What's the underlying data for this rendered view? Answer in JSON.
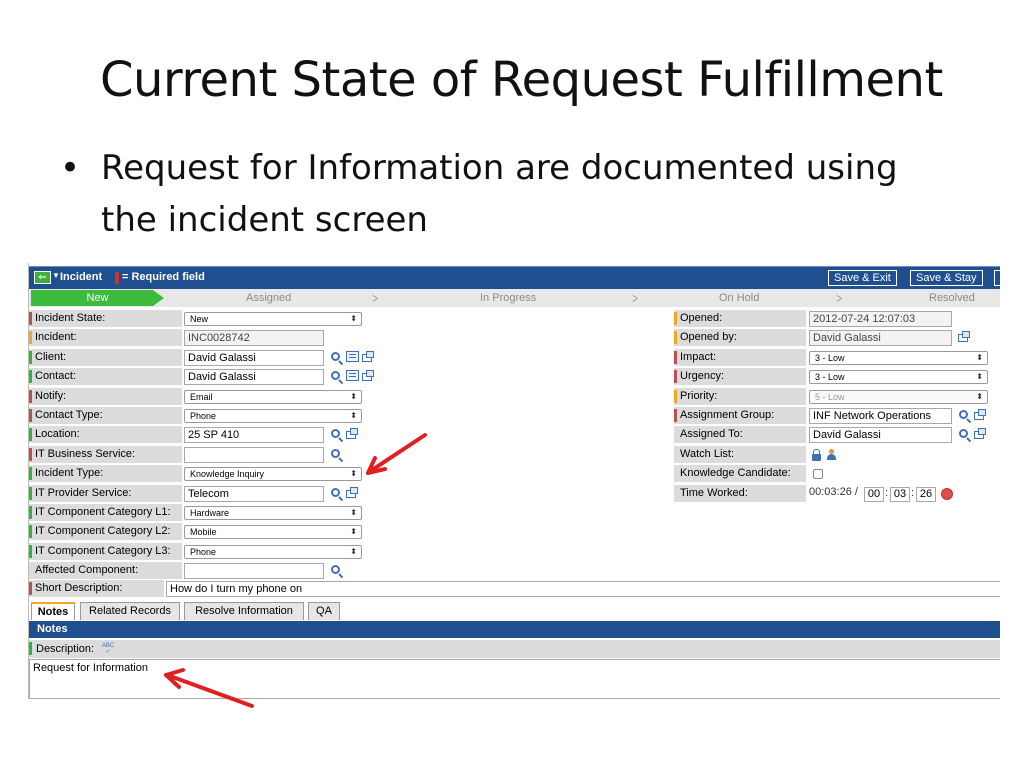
{
  "slide": {
    "title": "Current State of Request Fulfillment",
    "bullet": "Request for Information are documented using the incident screen"
  },
  "topbar": {
    "title": "Incident",
    "required_legend": "= Required field",
    "back_icon": "back-arrow-icon",
    "buttons": [
      "Save & Exit",
      "Save & Stay"
    ]
  },
  "flow": {
    "steps": [
      "New",
      "Assigned",
      "In Progress",
      "On Hold",
      "Resolved"
    ],
    "active": "New"
  },
  "left_fields": [
    {
      "label": "Incident State:",
      "mark": "red",
      "kind": "select",
      "value": "New"
    },
    {
      "label": "Incident:",
      "mark": "orange",
      "kind": "readonly",
      "value": "INC0028742"
    },
    {
      "label": "Client:",
      "mark": "green",
      "kind": "lookup",
      "value": "David Galassi",
      "icons": [
        "search-icon",
        "card-icon",
        "link-icon"
      ]
    },
    {
      "label": "Contact:",
      "mark": "green",
      "kind": "lookup",
      "value": "David Galassi",
      "icons": [
        "search-icon",
        "card-icon",
        "link-icon"
      ]
    },
    {
      "label": "Notify:",
      "mark": "red",
      "kind": "select",
      "value": "Email"
    },
    {
      "label": "Contact Type:",
      "mark": "red",
      "kind": "select",
      "value": "Phone"
    },
    {
      "label": "Location:",
      "mark": "green",
      "kind": "lookup",
      "value": "25 SP 410",
      "icons": [
        "search-icon",
        "link-icon"
      ]
    },
    {
      "label": "IT Business Service:",
      "mark": "red",
      "kind": "lookup",
      "value": "",
      "icons": [
        "search-icon"
      ]
    },
    {
      "label": "Incident Type:",
      "mark": "green",
      "kind": "select",
      "value": "Knowledge Inquiry"
    },
    {
      "label": "IT Provider Service:",
      "mark": "green",
      "kind": "lookup",
      "value": "Telecom",
      "icons": [
        "search-icon",
        "link-icon"
      ]
    },
    {
      "label": "IT Component Category L1:",
      "mark": "green",
      "kind": "select",
      "value": "Hardware"
    },
    {
      "label": "IT Component Category L2:",
      "mark": "green",
      "kind": "select",
      "value": "Mobile"
    },
    {
      "label": "IT Component Category L3:",
      "mark": "green",
      "kind": "select",
      "value": "Phone"
    },
    {
      "label": "Affected Component:",
      "mark": "none",
      "kind": "lookup",
      "value": "",
      "icons": [
        "search-icon"
      ]
    }
  ],
  "right_fields": [
    {
      "label": "Opened:",
      "mark": "orange",
      "kind": "readonly",
      "value": "2012-07-24 12:07:03"
    },
    {
      "label": "Opened by:",
      "mark": "orange",
      "kind": "readonly",
      "value": "David Galassi",
      "icons": [
        "link-icon"
      ]
    },
    {
      "label": "Impact:",
      "mark": "red",
      "kind": "select",
      "value": "3 - Low"
    },
    {
      "label": "Urgency:",
      "mark": "red",
      "kind": "select",
      "value": "3 - Low"
    },
    {
      "label": "Priority:",
      "mark": "orange",
      "kind": "select-disabled",
      "value": "5 - Low"
    },
    {
      "label": "Assignment Group:",
      "mark": "red",
      "kind": "lookup",
      "value": "INF Network Operations",
      "icons": [
        "search-icon",
        "link-icon"
      ]
    },
    {
      "label": "Assigned To:",
      "mark": "none",
      "kind": "lookup",
      "value": "David Galassi",
      "icons": [
        "search-icon",
        "link-icon"
      ]
    },
    {
      "label": "Watch List:",
      "mark": "none",
      "kind": "icons",
      "value": "",
      "icons": [
        "lock-icon",
        "add-person-icon"
      ]
    },
    {
      "label": "Knowledge Candidate:",
      "mark": "none",
      "kind": "checkbox",
      "value": ""
    },
    {
      "label": "Time Worked:",
      "mark": "none",
      "kind": "timer",
      "value": "00:03:26 /",
      "time": [
        "00",
        "03",
        "26"
      ]
    }
  ],
  "short_description": {
    "label": "Short Description:",
    "value": "How do I turn my phone on"
  },
  "tabs": [
    "Notes",
    "Related Records",
    "Resolve Information",
    "QA"
  ],
  "notes": {
    "header": "Notes",
    "description_label": "Description:",
    "spell_icon": "spell-check-icon",
    "description_value": "Request for Information"
  },
  "colors": {
    "header_blue": "#1f4f8e",
    "active_green": "#3cbb3c",
    "mandatory_red": "#c0504d",
    "arrow_red": "#e02020"
  }
}
